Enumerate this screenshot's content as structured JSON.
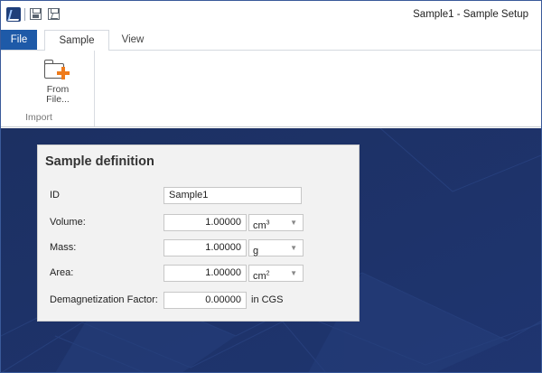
{
  "window": {
    "title": "Sample1 - Sample Setup",
    "accent_color": "#1e5aa8",
    "workspace_color": "#1d3266"
  },
  "quick_access": {
    "icons": [
      "app-icon",
      "save-icon",
      "save-as-icon"
    ]
  },
  "tabs": {
    "file": "File",
    "sample": "Sample",
    "view": "View",
    "active": "Sample"
  },
  "ribbon": {
    "from_file_line1": "From",
    "from_file_line2": "File...",
    "group_label": "Import"
  },
  "panel": {
    "title": "Sample definition",
    "id_label": "ID",
    "id_value": "Sample1",
    "fields": [
      {
        "label": "Volume:",
        "value": "1.00000",
        "unit": "cm",
        "unit_sup": "3"
      },
      {
        "label": "Mass:",
        "value": "1.00000",
        "unit": "g",
        "unit_sup": ""
      },
      {
        "label": "Area:",
        "value": "1.00000",
        "unit": "cm",
        "unit_sup": "2"
      }
    ],
    "demag_label": "Demagnetization Factor:",
    "demag_value": "0.00000",
    "demag_unit": "in CGS"
  }
}
